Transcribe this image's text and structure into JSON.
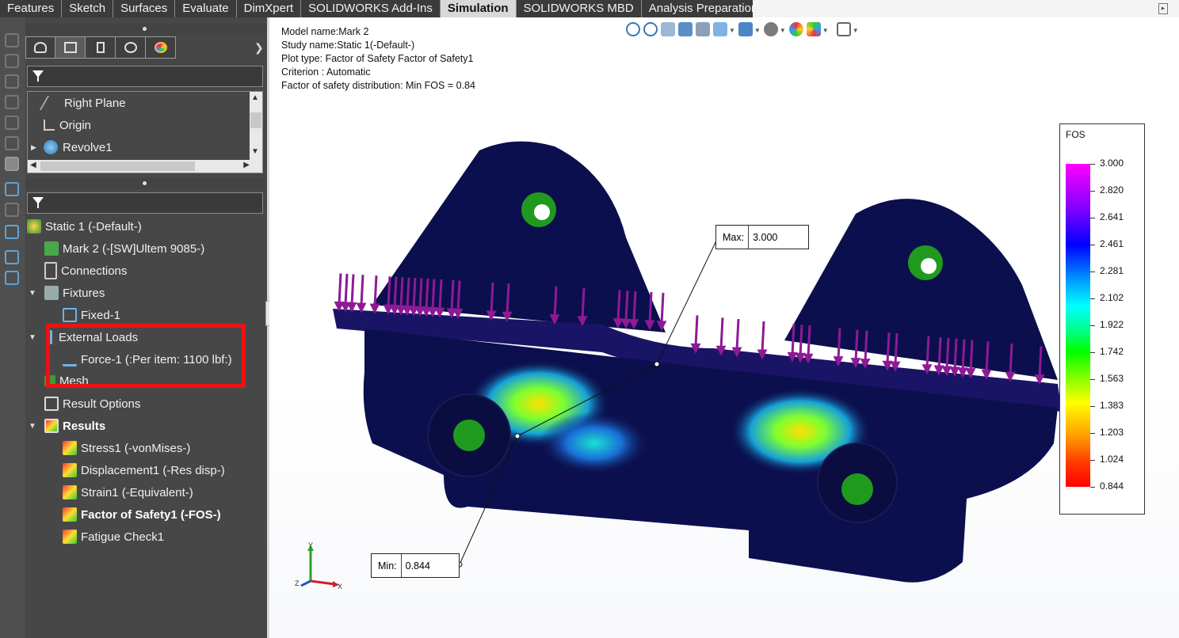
{
  "tabs": [
    {
      "label": "Features",
      "active": false
    },
    {
      "label": "Sketch",
      "active": false
    },
    {
      "label": "Surfaces",
      "active": false
    },
    {
      "label": "Evaluate",
      "active": false
    },
    {
      "label": "DimXpert",
      "active": false
    },
    {
      "label": "SOLIDWORKS Add-Ins",
      "active": false
    },
    {
      "label": "Simulation",
      "active": true
    },
    {
      "label": "SOLIDWORKS MBD",
      "active": false
    },
    {
      "label": "Analysis Preparation",
      "active": false
    }
  ],
  "feature_tree": {
    "items": [
      {
        "label": "Right Plane",
        "icon": "plane-icon"
      },
      {
        "label": "Origin",
        "icon": "origin-icon"
      },
      {
        "label": "Revolve1",
        "icon": "revolve-icon"
      }
    ]
  },
  "sim_tree": {
    "study": "Static 1 (-Default-)",
    "part": "Mark 2 (-[SW]Ultem 9085-)",
    "connections": "Connections",
    "fixtures": "Fixtures",
    "fixed": "Fixed-1",
    "external_loads": "External Loads",
    "force": "Force-1 (:Per item: 1100 lbf:)",
    "mesh": "Mesh",
    "result_options": "Result Options",
    "results": "Results",
    "result_items": [
      {
        "label": "Stress1 (-vonMises-)",
        "bold": false
      },
      {
        "label": "Displacement1 (-Res disp-)",
        "bold": false
      },
      {
        "label": "Strain1 (-Equivalent-)",
        "bold": false
      },
      {
        "label": "Factor of Safety1 (-FOS-)",
        "bold": true
      },
      {
        "label": "Fatigue Check1",
        "bold": false
      }
    ]
  },
  "info": {
    "model_name": "Model name:Mark 2",
    "study_name": "Study name:Static 1(-Default-)",
    "plot_type": "Plot type: Factor of Safety Factor of Safety1",
    "criterion": "Criterion : Automatic",
    "distribution": "Factor of safety distribution: Min FOS = 0.84"
  },
  "legend": {
    "title": "FOS",
    "labels": [
      "3.000",
      "2.820",
      "2.641",
      "2.461",
      "2.281",
      "2.102",
      "1.922",
      "1.742",
      "1.563",
      "1.383",
      "1.203",
      "1.024",
      "0.844"
    ],
    "colors": {
      "max": "#ff00ff",
      "min": "#ff0000"
    }
  },
  "max_callout": {
    "key": "Max:",
    "value": "3.000"
  },
  "min_callout": {
    "key": "Min:",
    "value": "0.844"
  },
  "axis": {
    "x": "X",
    "y": "Y",
    "z": "Z"
  },
  "colors": {
    "highlight": "#ee1111",
    "load_arrow": "#8e1a96",
    "model_base": "#0c0f4d",
    "fixture": "#1f9a1f"
  }
}
